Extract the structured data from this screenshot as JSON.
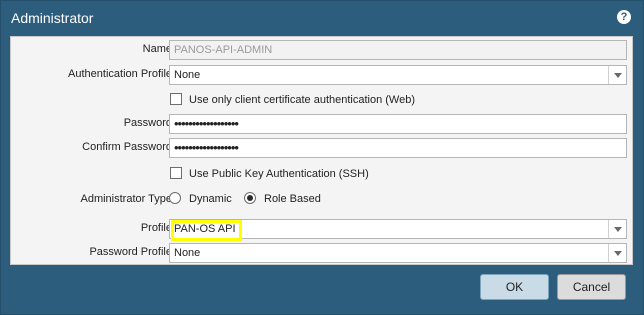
{
  "dialog": {
    "title": "Administrator",
    "help_icon": "help-icon",
    "help_glyph": "?"
  },
  "form": {
    "name_label": "Name",
    "name_value": "PANOS-API-ADMIN",
    "auth_profile_label": "Authentication Profile",
    "auth_profile_value": "None",
    "client_cert_label": "Use only client certificate authentication (Web)",
    "password_label": "Password",
    "password_value": "••••••••••••••••••",
    "confirm_password_label": "Confirm Password",
    "confirm_password_value": "••••••••••••••••••",
    "public_key_label": "Use Public Key Authentication (SSH)",
    "admin_type_label": "Administrator Type",
    "admin_type_options": [
      "Dynamic",
      "Role Based"
    ],
    "admin_type_selected": "Role Based",
    "profile_label": "Profile",
    "profile_value": "PAN-OS API",
    "password_profile_label": "Password Profile",
    "password_profile_value": "None"
  },
  "buttons": {
    "ok": "OK",
    "cancel": "Cancel"
  },
  "colors": {
    "titlebar": "#2d5d7c",
    "content_bg": "#f4f4f4",
    "highlight": "#ffff00",
    "ok_bg": "#c9dbe7"
  }
}
